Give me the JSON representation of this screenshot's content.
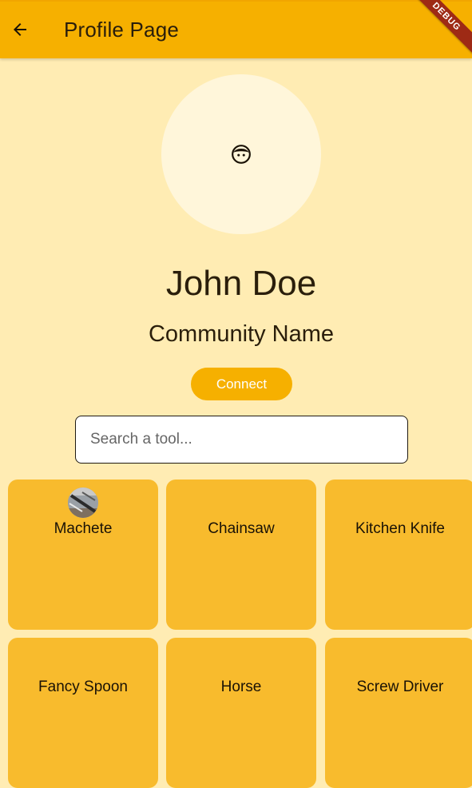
{
  "appbar": {
    "title": "Profile Page",
    "back_icon": "arrow-back-icon",
    "debug_banner": "DEBUG"
  },
  "profile": {
    "avatar_icon": "face-icon",
    "name": "John Doe",
    "community": "Community Name",
    "connect_label": "Connect"
  },
  "search": {
    "placeholder": "Search a tool...",
    "value": ""
  },
  "tools": [
    {
      "label": "Machete",
      "has_image": true
    },
    {
      "label": "Chainsaw",
      "has_image": false
    },
    {
      "label": "Kitchen Knife",
      "has_image": false
    },
    {
      "label": "Fancy Spoon",
      "has_image": false
    },
    {
      "label": "Horse",
      "has_image": false
    },
    {
      "label": "Screw Driver",
      "has_image": false
    }
  ],
  "colors": {
    "appbar": "#F6B000",
    "background": "#FFECB3",
    "card": "#F8BB2D",
    "avatar_bg": "#FFF6DA",
    "text": "#2a1e0b"
  }
}
